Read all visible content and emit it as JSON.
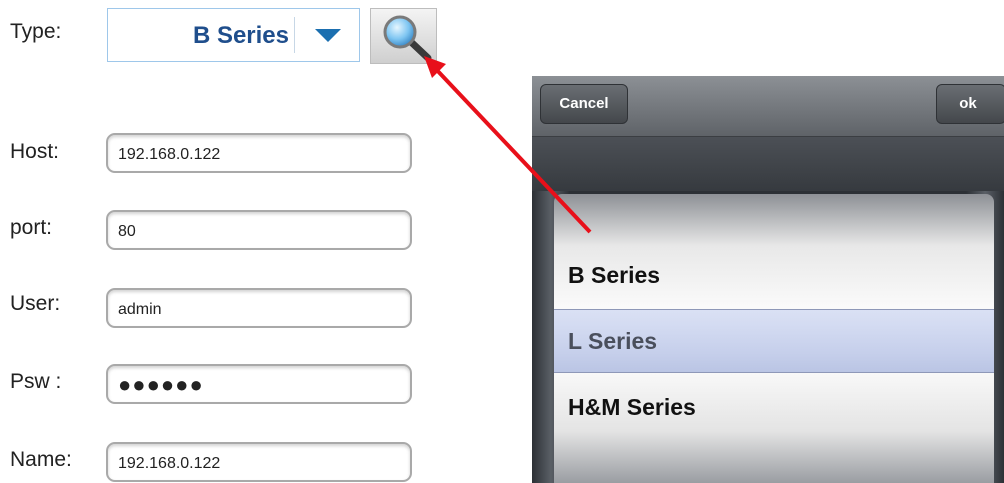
{
  "form": {
    "type": {
      "label": "Type:",
      "value": "B Series"
    },
    "host": {
      "label": "Host:",
      "value": "192.168.0.122"
    },
    "port": {
      "label": "port:",
      "value": "80"
    },
    "user": {
      "label": "User:",
      "value": "admin"
    },
    "password": {
      "label": "Psw :",
      "value": "●●●●●●"
    },
    "name": {
      "label": "Name:",
      "value": "192.168.0.122"
    }
  },
  "search_icon": "search-icon",
  "picker": {
    "cancel_label": "Cancel",
    "ok_label": "ok",
    "options": [
      "B Series",
      "L Series",
      "H&M Series"
    ],
    "selected": "L Series"
  },
  "colors": {
    "type_value": "#1f4e8c",
    "dropdown_arrow": "#1b6fb0",
    "annotation_arrow": "#e8101a"
  }
}
